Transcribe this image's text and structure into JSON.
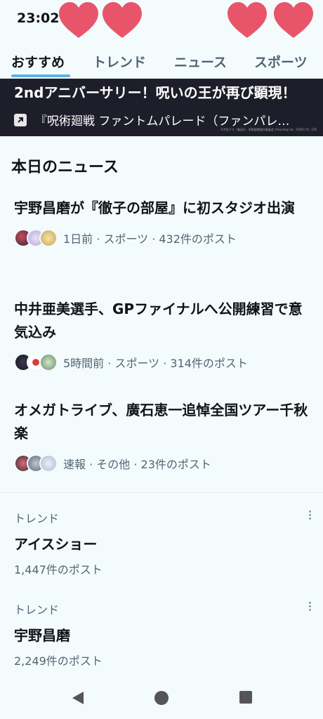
{
  "status": {
    "time": "23:02"
  },
  "tabs": [
    {
      "label": "おすすめ",
      "active": true
    },
    {
      "label": "トレンド"
    },
    {
      "label": "ニュース"
    },
    {
      "label": "スポーツ"
    }
  ],
  "banner": {
    "title": "2ndアニバーサリー！呪いの王が再び顕現！",
    "link": "『呪術廻戦 ファントムパレード（ファンパレ…",
    "fine_print": "©芥見下々／集英社・呪術廻戦製作委員会 ©Sumzap Inc. TOHO CO., LTD."
  },
  "section_title": "本日のニュース",
  "news": [
    {
      "headline": "宇野昌磨が『徹子の部屋』に初スタジオ出演",
      "meta": "1日前 · スポーツ · 432件のポスト"
    },
    {
      "headline": "中井亜美選手、GPファイナルへ公開練習で意気込み",
      "meta": "5時間前 · スポーツ · 314件のポスト"
    },
    {
      "headline": "オメガトライブ、廣石恵一追悼全国ツアー千秋楽",
      "meta": "速報 · その他 · 23件のポスト"
    }
  ],
  "trends": [
    {
      "label": "トレンド",
      "name": "アイスショー",
      "posts": "1,447件のポスト"
    },
    {
      "label": "トレンド",
      "name": "宇野昌磨",
      "posts": "2,249件のポスト"
    }
  ],
  "icons": {
    "heart": "heart-icon",
    "external_link": "external-link-icon",
    "more": "more-vertical-icon",
    "back": "nav-back-icon",
    "home": "nav-home-icon",
    "recents": "nav-recents-icon"
  },
  "colors": {
    "background": "#f3fbfd",
    "accent": "#5bb3e6",
    "heart": "#e8556a",
    "banner_bg": "#1e1e2a",
    "secondary_text": "#536471"
  }
}
